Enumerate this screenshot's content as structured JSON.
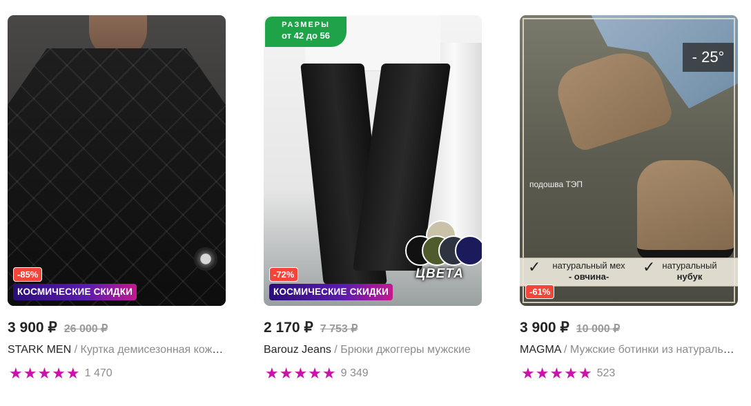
{
  "products": [
    {
      "discount": "-85%",
      "promo": "КОСМИЧЕСКИЕ СКИДКИ",
      "price": "3 900 ₽",
      "old_price": "26 000 ₽",
      "brand": "STARK MEN",
      "separator": " / ",
      "name": "Куртка демисезонная кожаная",
      "stars": "★★★★★",
      "reviews": "1 470"
    },
    {
      "size_badge_line1": "РАЗМЕРЫ",
      "size_badge_line2": "от 42 до 56",
      "colors_label": "ЦВЕТА",
      "discount": "-72%",
      "promo": "КОСМИЧЕСКИЕ СКИДКИ",
      "price": "2 170 ₽",
      "old_price": "7 753 ₽",
      "brand": "Barouz Jeans",
      "separator": " / ",
      "name": "Брюки джоггеры мужские",
      "stars": "★★★★★",
      "reviews": "9 349",
      "swatch_colors": [
        "#c9c1a8",
        "#111111",
        "#4f5b2c",
        "#2e3340",
        "#1b1a5a"
      ]
    },
    {
      "temperature": "- 25°",
      "sole_label": "подошва ТЭП",
      "feature1_line1": "натуральный мех",
      "feature1_line2": "- овчина-",
      "feature2_line1": "натуральный",
      "feature2_line2": "нубук",
      "discount": "-61%",
      "price": "3 900 ₽",
      "old_price": "10 000 ₽",
      "brand": "MAGMA",
      "separator": " / ",
      "name": "Мужские ботинки из натуральной кожи",
      "stars": "★★★★★",
      "reviews": "523"
    }
  ],
  "colors": {
    "star": "#cb11ab",
    "discount": "#f5443a",
    "green_badge": "#1fa348"
  }
}
